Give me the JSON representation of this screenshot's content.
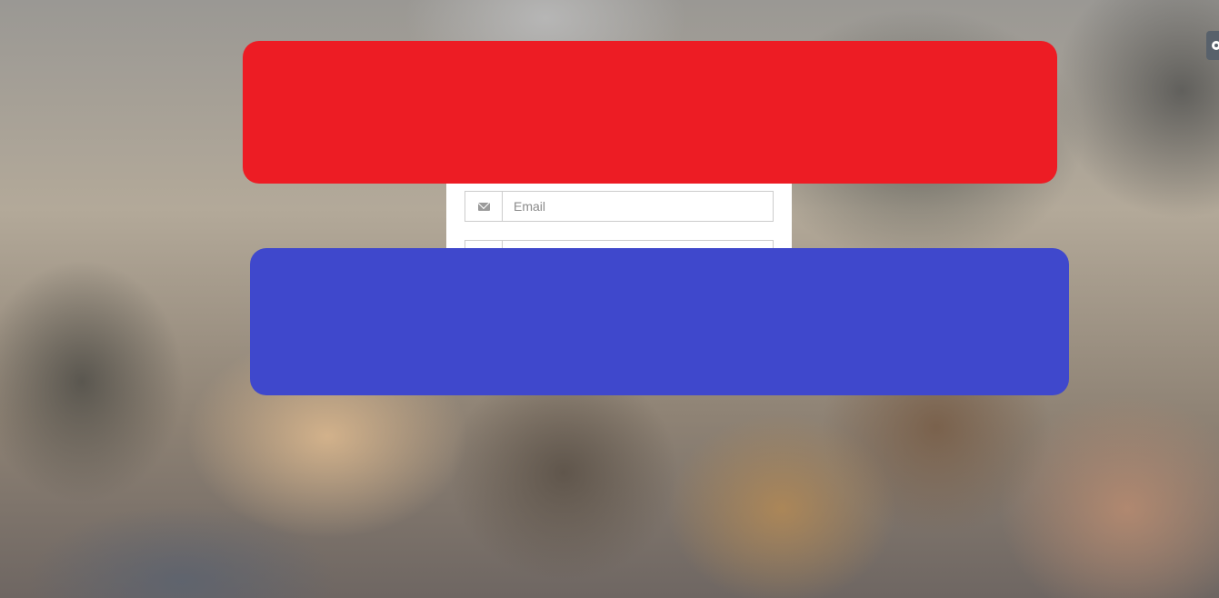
{
  "login_form": {
    "email_icon": "envelope-icon",
    "email_placeholder": "Email",
    "email_value": "",
    "second_field_placeholder": "",
    "second_field_value": ""
  },
  "settings": {
    "icon": "gear-icon"
  },
  "redactions": {
    "top_color": "#ed1c24",
    "bottom_color": "#3f48cc"
  }
}
